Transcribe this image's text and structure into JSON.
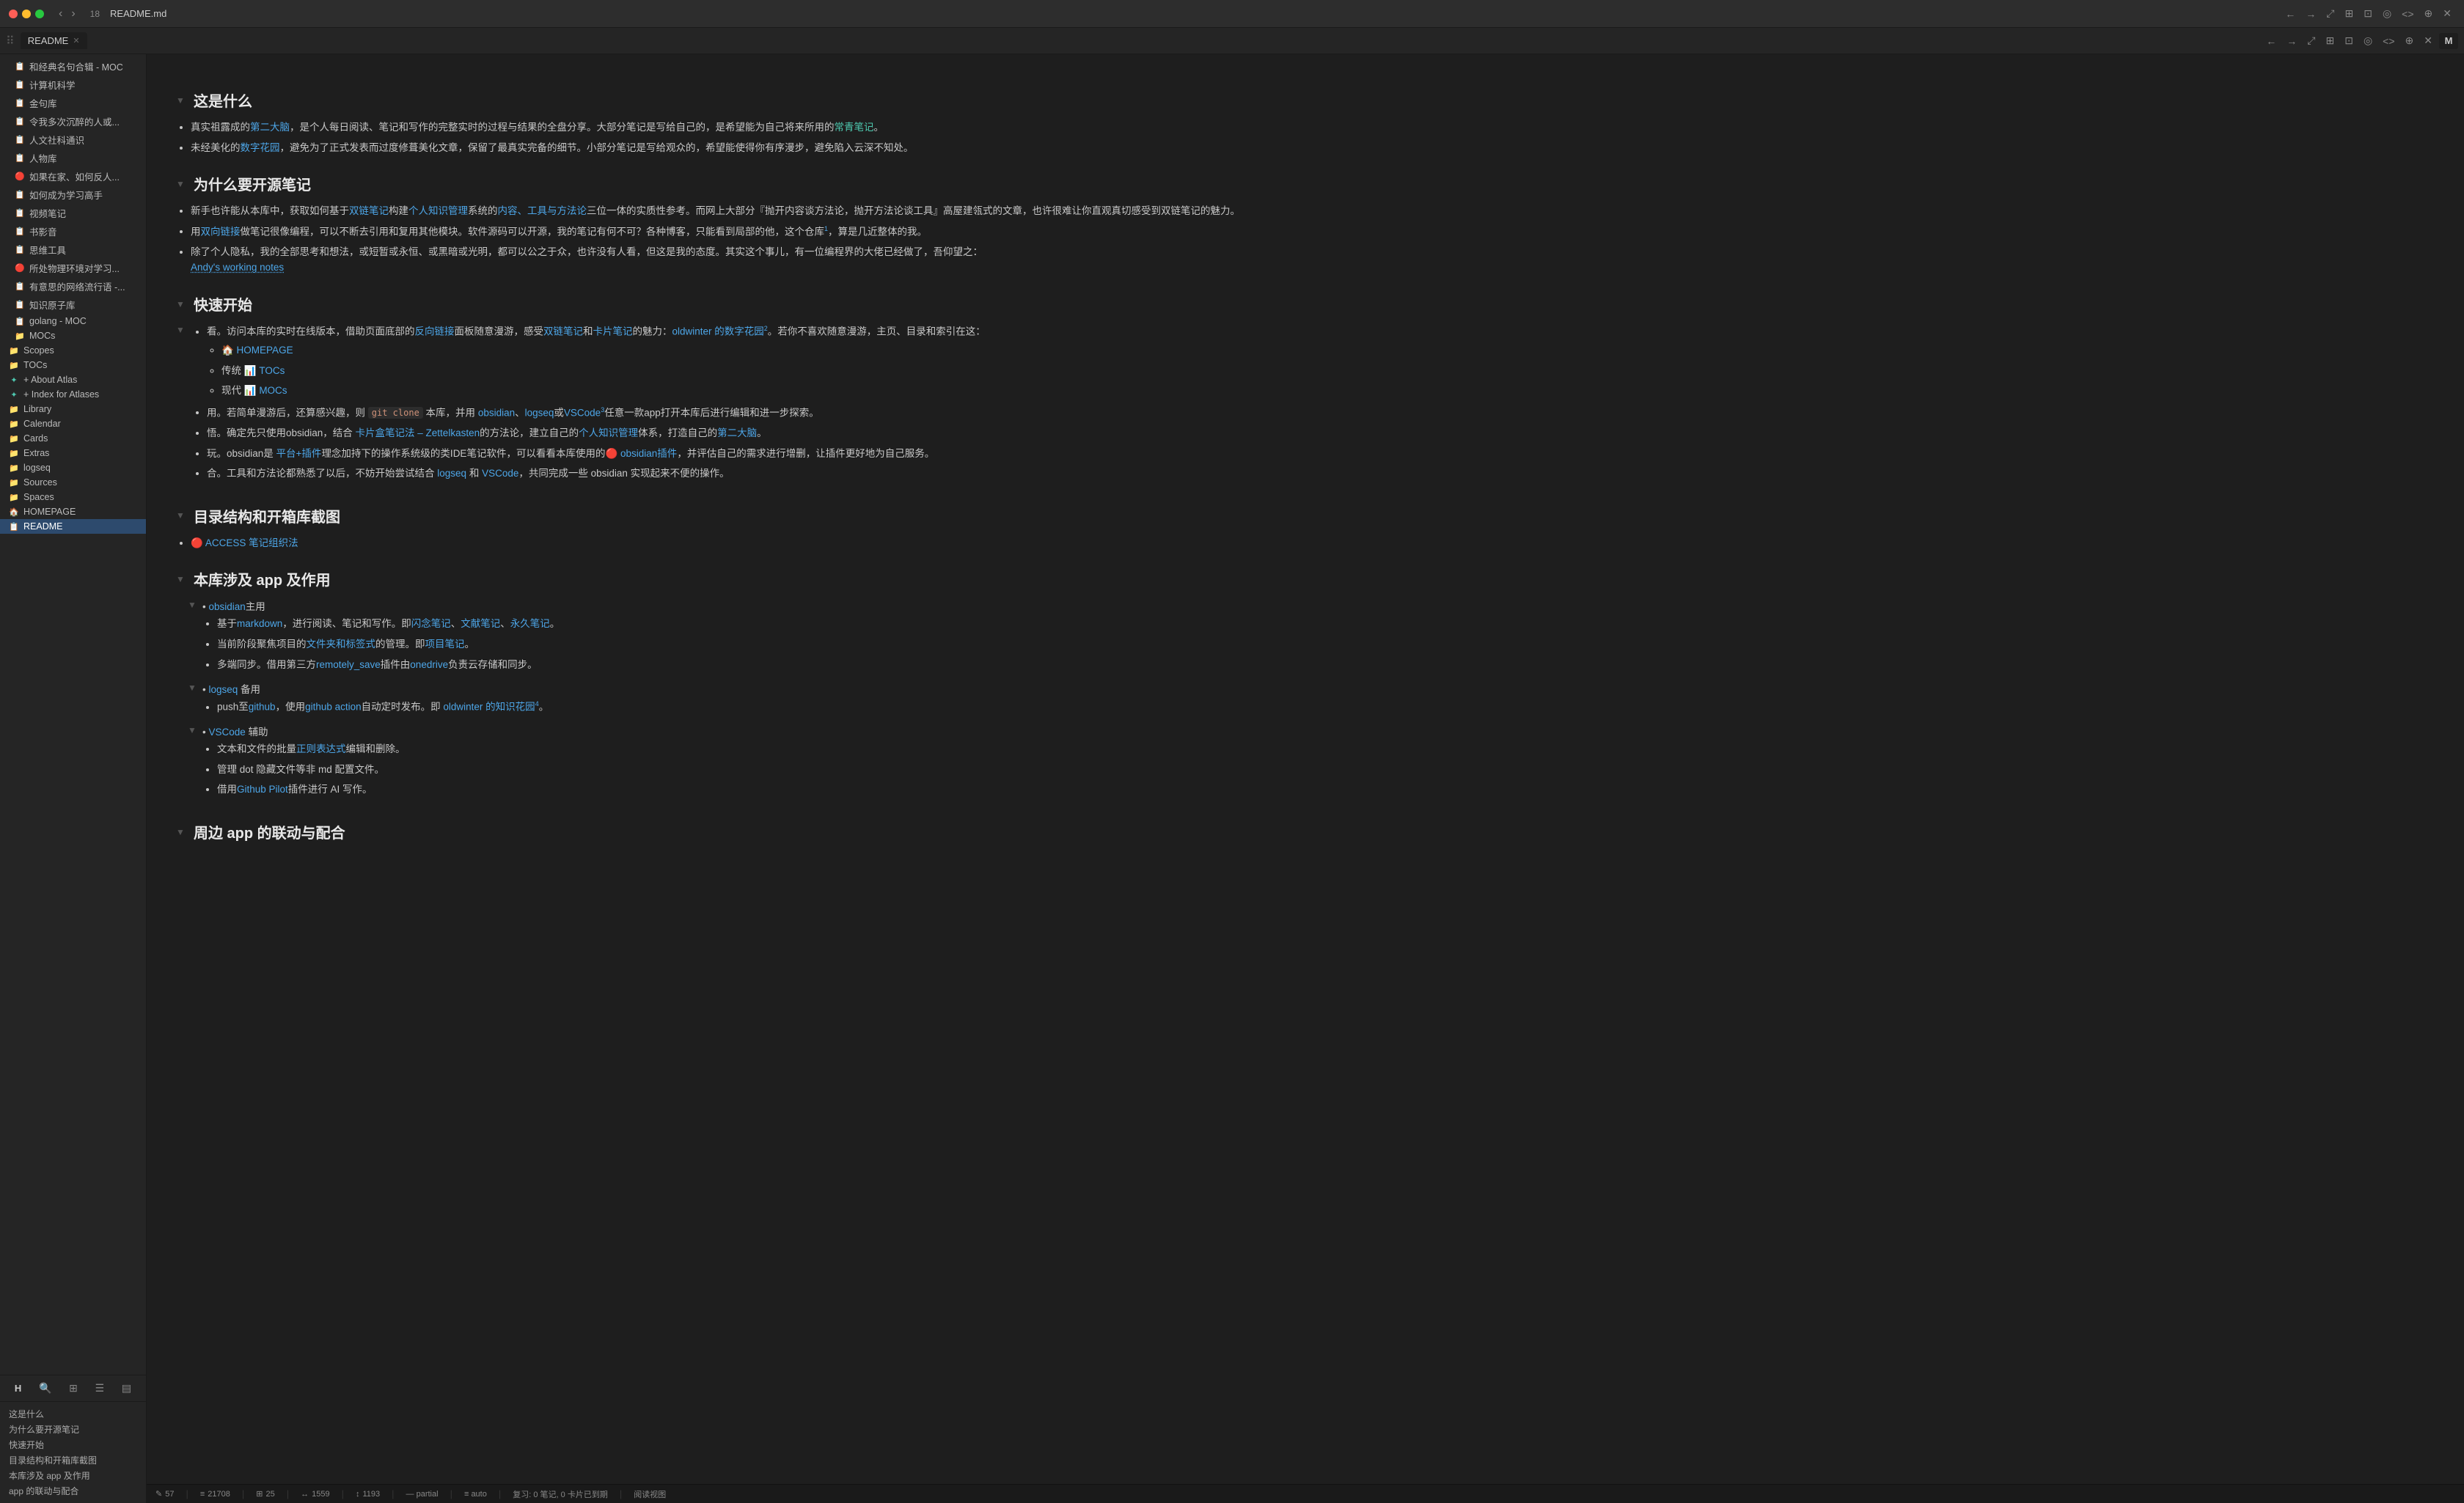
{
  "titlebar": {
    "traffic": [
      "close",
      "minimize",
      "maximize"
    ],
    "back_label": "←",
    "forward_label": "→",
    "tab_count": "18",
    "filename": "README.md",
    "right_icons": [
      "←",
      "→",
      "↑",
      "⤢",
      "⊞",
      "⊡",
      "◎",
      "<>",
      "⊕",
      "✕"
    ],
    "M_label": "M"
  },
  "tabbar": {
    "drag_icon": "⠿",
    "tab_label": "README",
    "tab_close": "✕",
    "right_icons": [
      "←",
      "→",
      "↗",
      "⤢",
      "⊞",
      "⊡",
      "◎",
      "<>",
      "⊕",
      "✕"
    ]
  },
  "sidebar": {
    "items": [
      {
        "id": "si1",
        "label": "和经典名句合辑 - MOC",
        "icon": "📋",
        "indent": 1
      },
      {
        "id": "si2",
        "label": "计算机科学",
        "icon": "📋",
        "indent": 1
      },
      {
        "id": "si3",
        "label": "金句库",
        "icon": "📋",
        "indent": 1
      },
      {
        "id": "si4",
        "label": "令我多次沉醉的人或...",
        "icon": "📋",
        "indent": 1
      },
      {
        "id": "si5",
        "label": "人文社科通识",
        "icon": "📋",
        "indent": 1
      },
      {
        "id": "si6",
        "label": "人物库",
        "icon": "📋",
        "indent": 1
      },
      {
        "id": "si7",
        "label": "如果在家、如何反人...",
        "icon": "🔴",
        "indent": 1
      },
      {
        "id": "si8",
        "label": "如何成为学习高手",
        "icon": "📋",
        "indent": 1
      },
      {
        "id": "si9",
        "label": "视频笔记",
        "icon": "📋",
        "indent": 1
      },
      {
        "id": "si10",
        "label": "书影音",
        "icon": "📋",
        "indent": 1
      },
      {
        "id": "si11",
        "label": "思维工具",
        "icon": "📋",
        "indent": 1
      },
      {
        "id": "si12",
        "label": "所处物理环境对学习...",
        "icon": "🔴",
        "indent": 1
      },
      {
        "id": "si13",
        "label": "有意思的网络流行语 -...",
        "icon": "📋",
        "indent": 1
      },
      {
        "id": "si14",
        "label": "知识原子库",
        "icon": "📋",
        "indent": 1
      },
      {
        "id": "si15",
        "label": "golang - MOC",
        "icon": "📋",
        "indent": 1
      },
      {
        "id": "si16",
        "label": "MOCs",
        "icon": "📁",
        "indent": 1
      },
      {
        "id": "si17",
        "label": "Scopes",
        "icon": "📁",
        "indent": 0
      },
      {
        "id": "si18",
        "label": "TOCs",
        "icon": "📁",
        "indent": 0
      },
      {
        "id": "si19",
        "label": "+ About Atlas",
        "icon": "✚",
        "indent": 0
      },
      {
        "id": "si20",
        "label": "+ Index for Atlases",
        "icon": "✚",
        "indent": 0
      },
      {
        "id": "si21",
        "label": "Library",
        "icon": "📁",
        "indent": 0
      },
      {
        "id": "si22",
        "label": "Calendar",
        "icon": "📁",
        "indent": 0
      },
      {
        "id": "si23",
        "label": "Cards",
        "icon": "📁",
        "indent": 0
      },
      {
        "id": "si24",
        "label": "Extras",
        "icon": "📁",
        "indent": 0
      },
      {
        "id": "si25",
        "label": "logseq",
        "icon": "📁",
        "indent": 0
      },
      {
        "id": "si26",
        "label": "Sources",
        "icon": "📁",
        "indent": 0
      },
      {
        "id": "si27",
        "label": "Spaces",
        "icon": "📁",
        "indent": 0
      },
      {
        "id": "si28",
        "label": "HOMEPAGE",
        "icon": "🏠",
        "indent": 0
      },
      {
        "id": "si29",
        "label": "README",
        "icon": "📋",
        "indent": 0,
        "active": true
      }
    ],
    "bottom_tools": [
      "H",
      "🔍",
      "⊞",
      "☰",
      "▤"
    ]
  },
  "outline": {
    "items": [
      "这是什么",
      "为什么要开源笔记",
      "快速开始",
      "目录结构和开箱库截图",
      "本库涉及 app 及作用",
      "app 的联动与配合"
    ]
  },
  "content": {
    "title": "README",
    "sections": [
      {
        "id": "s1",
        "heading": "这是什么",
        "bullets": [
          "真实祖露成的<第二大脑>，是个人每日阅读、笔记和写作的完整实时的过程与结果的全盘分享。大部分笔记是写给自己的，是希望能为自己将来所用的<常青笔记>。",
          "未经美化的<数字花园>，避免为了正式发表而过度修葺美化文章，保留了最真实完备的细节。小部分笔记是写给观众的，希望能使得你有序漫步，避免陷入云深不知处。"
        ]
      },
      {
        "id": "s2",
        "heading": "为什么要开源笔记",
        "bullets": [
          "新手也许能从本库中，获取如何基于<双链笔记>构建<个人知识管理>系统的<内容、工具与方法论>三位一体的实质性参考。而网上大部分『抛开内容谈方法论，抛开方法论谈工具』高屋建瓴式的文章，也许很难让你直观真切感受到双链笔记的魅力。",
          "用<双向链接>做笔记很像编程，可以不断去引用和复用其他模块。软件源码可以开源，我的笔记有何不可？各种博客，只能看到局部的他，这个仓库[1]，算是几近整体的我。",
          "除了个人隐私，我的全部思考和想法，或短暂或永恒、或黑暗或光明，都可以公之于众，也许没有人看，但这是我的态度。其实这个事儿，有一位编程界的大佬已经做了，吾仰望之：Andy's working notes"
        ]
      },
      {
        "id": "s3",
        "heading": "快速开始",
        "sub_items": [
          {
            "type": "bullet",
            "text": "看。访问本库的实时在线版本，借助页面底部的<反向链接>面板随意漫游，感受<双链笔记>和<卡片笔记>的魅力：oldwinter 的数字花园[2]。若你不喜欢随意漫游，主页、目录和索引在这：",
            "sub": [
              "🏠 HOMEPAGE",
              "传统 📊 TOCs",
              "现代 📊 MOCs"
            ]
          },
          {
            "type": "bullet",
            "text": "用。若简单漫游后，还算感兴趣，则 git clone 本库，并用 obsidian、logseq或VSCode[3]任意一款app打开本库后进行编辑和进一步探索。"
          },
          {
            "type": "bullet",
            "text": "悟。确定先只使用obsidian，结合 <卡片盒笔记法 – Zettelkasten>的方法论，建立自己的<个人知识管理>体系，打造自己的<第二大脑>。"
          },
          {
            "type": "bullet",
            "text": "玩。obsidian是 <平台+插件>理念加持下的操作系统级的类IDE笔记软件，可以看看本库使用的🔴 <obsidian插件>，并评估自己的需求进行增删，让插件更好地为自己服务。"
          },
          {
            "type": "bullet",
            "text": "合。工具和方法论都熟悉了以后，不妨开始尝试结合 logseq 和 VSCode，共同完成一些 obsidian 实现起来不便的操作。"
          }
        ]
      },
      {
        "id": "s4",
        "heading": "目录结构和开箱库截图",
        "bullets": [
          "🔴 ACCESS 笔记组织法"
        ]
      },
      {
        "id": "s5",
        "heading": "本库涉及 app 及作用",
        "sub_items": [
          {
            "type": "collapsible",
            "label": "obsidian主用",
            "children": [
              "基于<markdown>，进行阅读、笔记和写作。即<闪念笔记>、<文献笔记>、<永久笔记>。",
              "当前阶段聚焦项目的<文件夹和标签式>的管理。即<项目笔记>。",
              "多端同步。借用第三方<remotely_save>插件由<onedrive>负责云存储和同步。"
            ]
          },
          {
            "type": "collapsible",
            "label": "logseq 备用",
            "children": [
              "push至<github>，使用<github action>自动定时发布。即 oldwinter 的知识花园[4]。"
            ]
          },
          {
            "type": "collapsible",
            "label": "VSCode 辅助",
            "children": [
              "文本和文件的批量<正则表达式>编辑和删除。",
              "管理 dot 隐藏文件等非 md 配置文件。",
              "借用<Github Pilot>插件进行 AI 写作。"
            ]
          }
        ]
      },
      {
        "id": "s6",
        "heading": "周边 app 的联动与配合"
      }
    ]
  },
  "statusbar": {
    "items": [
      {
        "icon": "✎",
        "text": "57"
      },
      {
        "icon": "≡",
        "text": "21708"
      },
      {
        "icon": "⊞",
        "text": "25"
      },
      {
        "icon": "↔",
        "text": "1559"
      },
      {
        "icon": "↕",
        "text": "1193"
      },
      {
        "text": "— partial"
      },
      {
        "text": "≡ auto"
      },
      {
        "text": "复习: 0 笔记, 0 卡片已到期"
      },
      {
        "text": "阅读视图"
      }
    ]
  }
}
